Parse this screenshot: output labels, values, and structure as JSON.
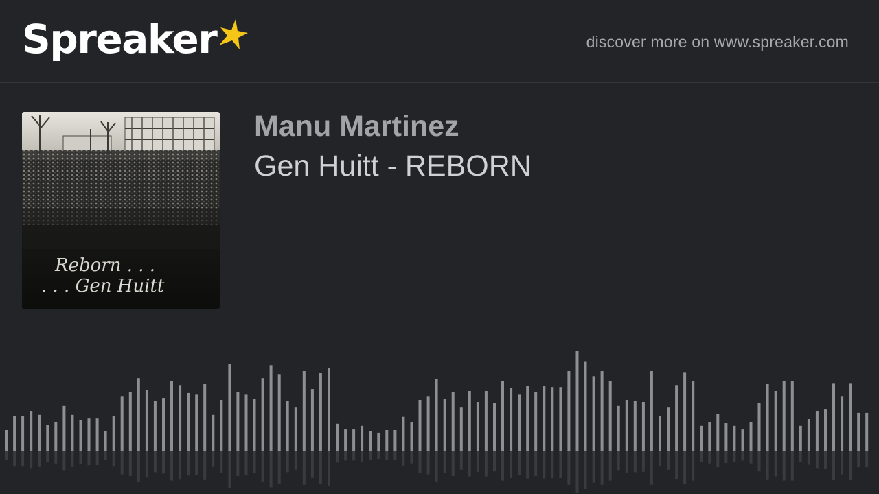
{
  "header": {
    "logo_text": "Spreaker",
    "discover_label": "discover more on www.spreaker.com"
  },
  "episode": {
    "author": "Manu Martinez",
    "title": "Gen Huitt - REBORN",
    "cover_caption_line1": "Reborn . . .",
    "cover_caption_line2": ". . . Gen Huitt"
  },
  "colors": {
    "background": "#232428",
    "accent_star": "#f5c518",
    "wave_bar": "#8e8f93"
  },
  "waveform": {
    "levels": [
      0.21,
      0.35,
      0.35,
      0.4,
      0.36,
      0.26,
      0.29,
      0.45,
      0.36,
      0.31,
      0.33,
      0.33,
      0.2,
      0.35,
      0.55,
      0.59,
      0.73,
      0.61,
      0.5,
      0.53,
      0.7,
      0.66,
      0.58,
      0.57,
      0.67,
      0.36,
      0.51,
      0.87,
      0.59,
      0.57,
      0.52,
      0.73,
      0.86,
      0.77,
      0.5,
      0.44,
      0.8,
      0.62,
      0.78,
      0.83,
      0.27,
      0.22,
      0.22,
      0.25,
      0.2,
      0.18,
      0.21,
      0.21,
      0.34,
      0.29,
      0.51,
      0.55,
      0.72,
      0.52,
      0.59,
      0.44,
      0.6,
      0.49,
      0.6,
      0.48,
      0.7,
      0.63,
      0.57,
      0.65,
      0.59,
      0.65,
      0.64,
      0.64,
      0.8,
      1.0,
      0.9,
      0.75,
      0.8,
      0.7,
      0.45,
      0.51,
      0.5,
      0.49,
      0.8,
      0.35,
      0.44,
      0.66,
      0.79,
      0.7,
      0.25,
      0.29,
      0.37,
      0.28,
      0.25,
      0.22,
      0.29,
      0.48,
      0.67,
      0.6,
      0.7,
      0.7,
      0.25,
      0.32,
      0.4,
      0.42,
      0.68,
      0.55,
      0.68,
      0.38,
      0.38
    ]
  }
}
